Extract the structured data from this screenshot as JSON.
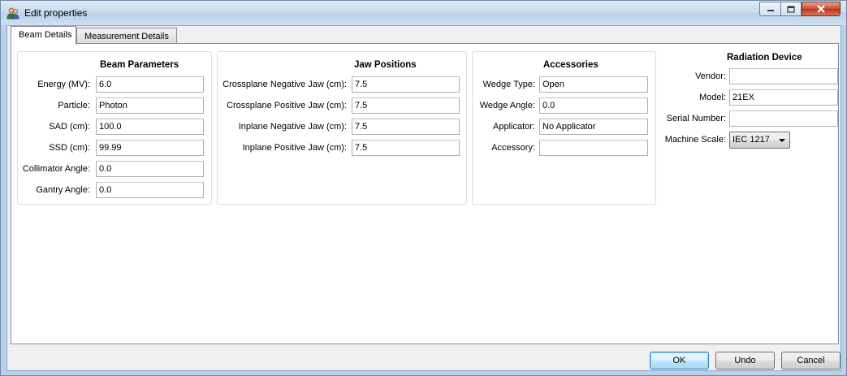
{
  "window": {
    "title": "Edit properties"
  },
  "tabs": [
    {
      "label": "Beam Details",
      "active": true
    },
    {
      "label": "Measurement Details",
      "active": false
    }
  ],
  "beam_parameters": {
    "title": "Beam Parameters",
    "fields": [
      {
        "label": "Energy (MV):",
        "value": "6.0"
      },
      {
        "label": "Particle:",
        "value": "Photon"
      },
      {
        "label": "SAD (cm):",
        "value": "100.0"
      },
      {
        "label": "SSD (cm):",
        "value": "99.99"
      },
      {
        "label": "Collimator Angle:",
        "value": "0.0"
      },
      {
        "label": "Gantry Angle:",
        "value": "0.0"
      }
    ]
  },
  "jaw_positions": {
    "title": "Jaw Positions",
    "fields": [
      {
        "label": "Crossplane Negative Jaw (cm):",
        "value": "7.5"
      },
      {
        "label": "Crossplane Positive Jaw (cm):",
        "value": "7.5"
      },
      {
        "label": "Inplane Negative Jaw (cm):",
        "value": "7.5"
      },
      {
        "label": "Inplane Positive Jaw (cm):",
        "value": "7.5"
      }
    ]
  },
  "accessories": {
    "title": "Accessories",
    "fields": [
      {
        "label": "Wedge Type:",
        "value": "Open"
      },
      {
        "label": "Wedge Angle:",
        "value": "0.0"
      },
      {
        "label": "Applicator:",
        "value": "No Applicator"
      },
      {
        "label": "Accessory:",
        "value": ""
      }
    ]
  },
  "radiation_device": {
    "title": "Radiation Device",
    "fields": [
      {
        "label": "Vendor:",
        "value": ""
      },
      {
        "label": "Model:",
        "value": "21EX"
      },
      {
        "label": "Serial Number:",
        "value": ""
      }
    ],
    "machine_scale": {
      "label": "Machine Scale:",
      "value": "IEC 1217"
    }
  },
  "buttons": {
    "ok": "OK",
    "undo": "Undo",
    "cancel": "Cancel"
  },
  "colors": {
    "titlebar": "#c9dbef",
    "close_button": "#c74a2f",
    "default_button_border": "#3c7fb1"
  }
}
